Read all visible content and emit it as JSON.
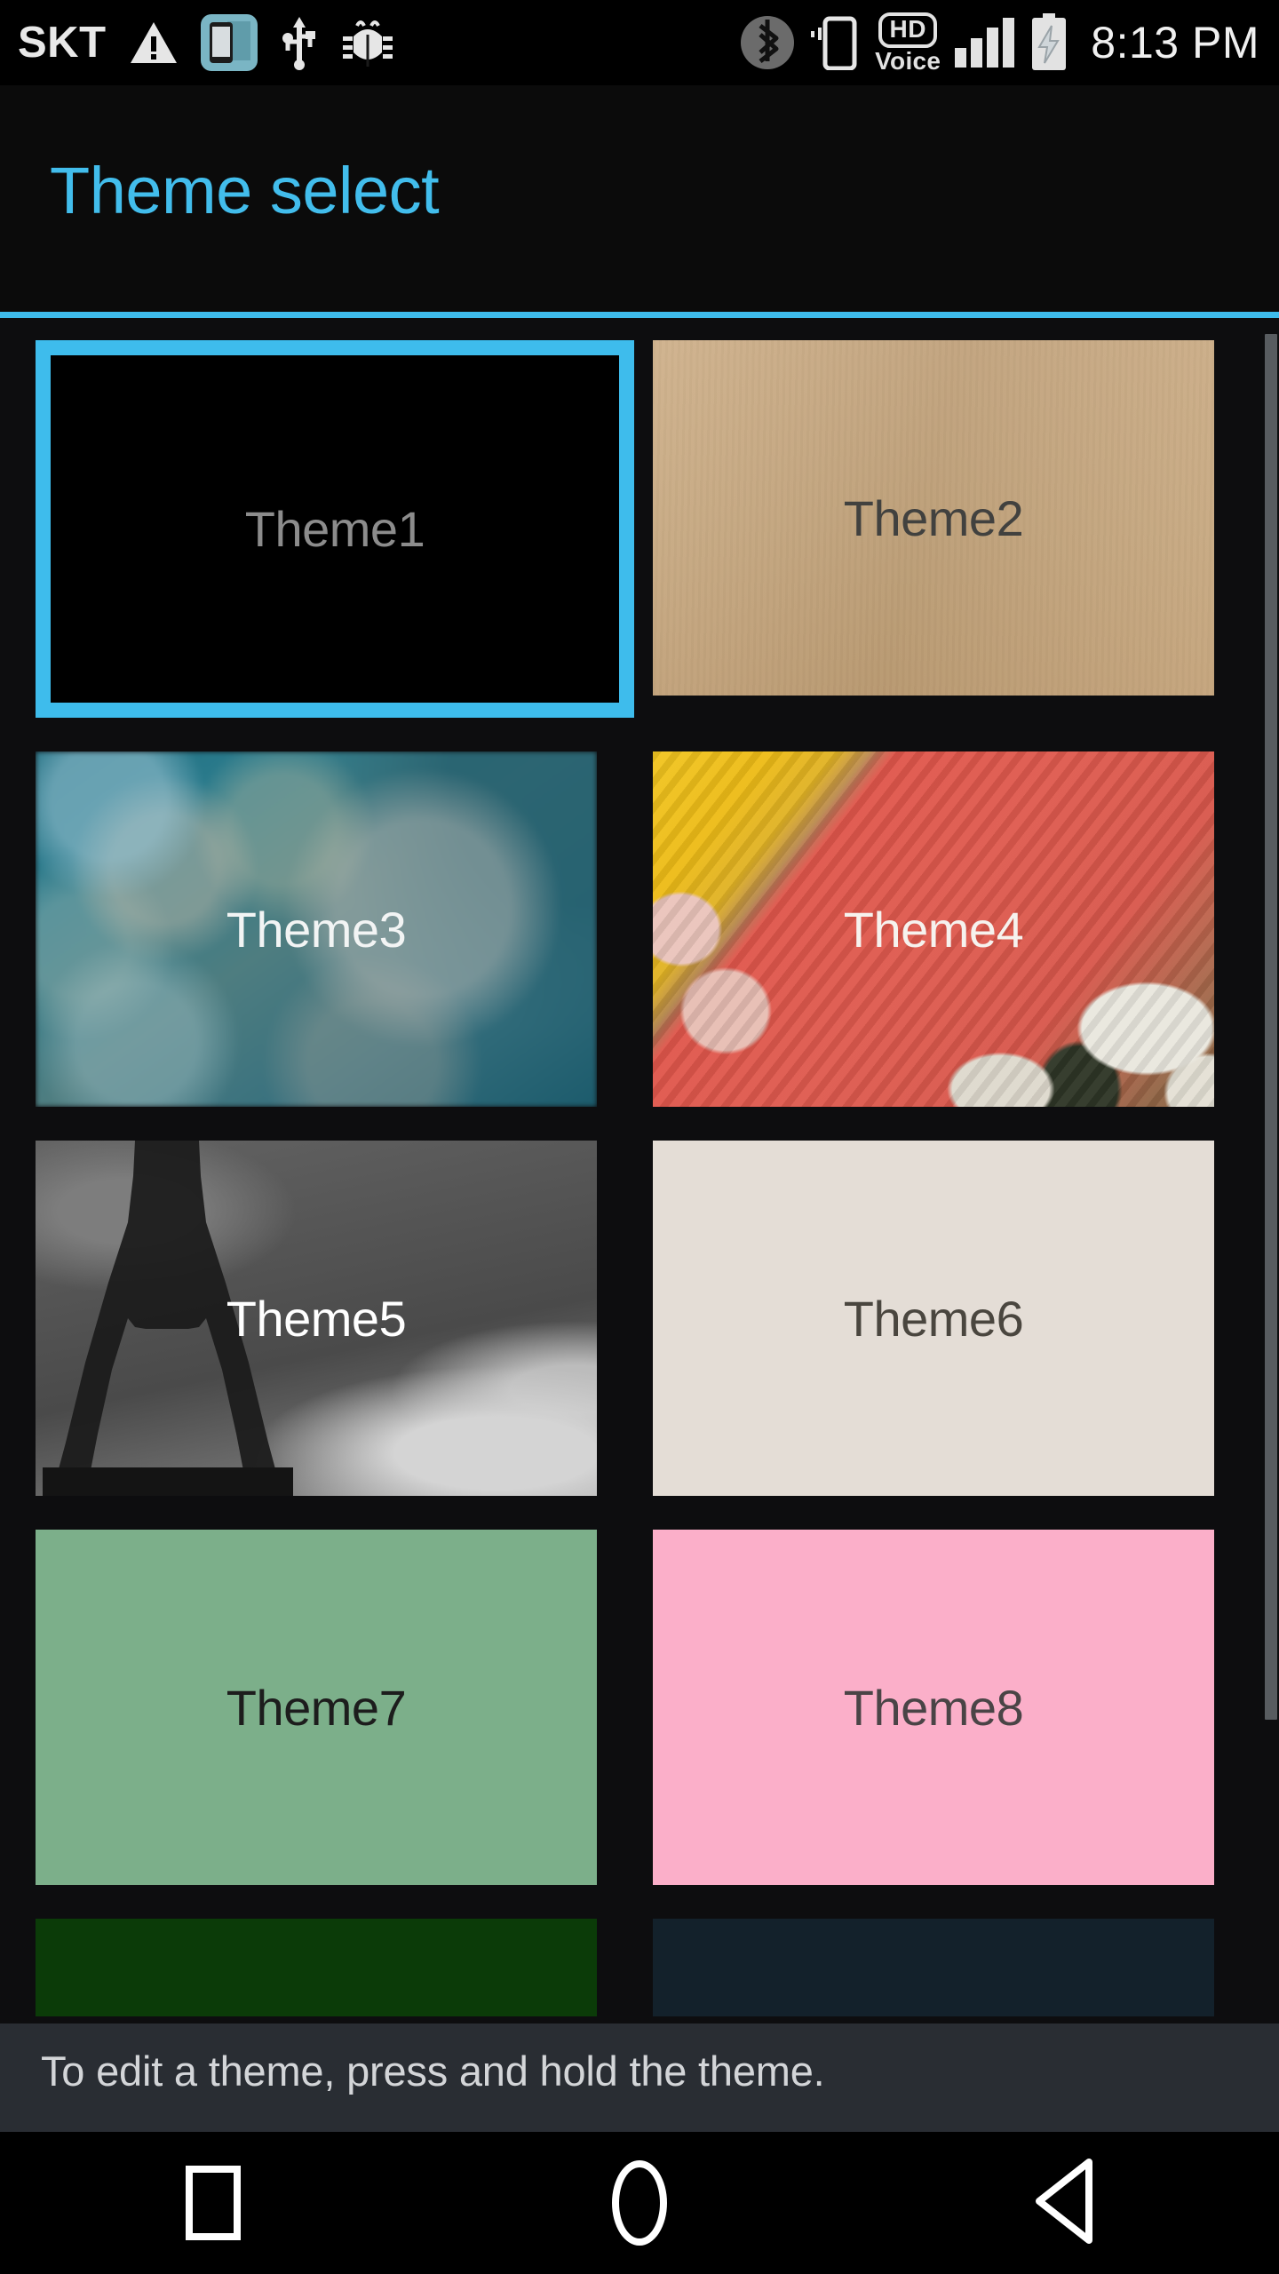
{
  "status_bar": {
    "carrier": "SKT",
    "clock": "8:13 PM",
    "hd_badge": "HD",
    "voice_label": "Voice",
    "icons": [
      "warning-triangle-icon",
      "smart-share-phone-icon",
      "usb-icon",
      "adb-bug-icon",
      "bluetooth-icon",
      "vibrate-phone-icon",
      "hd-voice-icon",
      "signal-bars-icon",
      "battery-charging-icon"
    ],
    "signal_bars": 4,
    "battery_charging": true
  },
  "action_bar": {
    "title": "Theme select",
    "accent_color": "#3ebcec"
  },
  "content": {
    "hint": "To edit a theme, press and hold the theme.",
    "selected_theme": "Theme1",
    "themes": [
      {
        "label": "Theme1",
        "art": "art-black",
        "text_color": "#8c8c8c",
        "swatch": "#000000",
        "selected": true,
        "partial": false
      },
      {
        "label": "Theme2",
        "art": "art-paper",
        "text_color": "#41413f",
        "swatch": "#c7a87f",
        "selected": false,
        "partial": false
      },
      {
        "label": "Theme3",
        "art": "art-bokeh",
        "text_color": "#f2f4f4",
        "swatch": "#2b7b8c",
        "selected": false,
        "partial": false
      },
      {
        "label": "Theme4",
        "art": "art-macaron",
        "text_color": "#f6f2ee",
        "swatch": "#d8574b",
        "selected": false,
        "partial": false
      },
      {
        "label": "Theme5",
        "art": "art-eiffel",
        "text_color": "#ffffff",
        "swatch": "#6e6e6e",
        "selected": false,
        "partial": false
      },
      {
        "label": "Theme6",
        "art": "art-cream",
        "text_color": "#4a463f",
        "swatch": "#e4ddd6",
        "selected": false,
        "partial": false
      },
      {
        "label": "Theme7",
        "art": "art-green",
        "text_color": "#1d1d1d",
        "swatch": "#7caf8a",
        "selected": false,
        "partial": false
      },
      {
        "label": "Theme8",
        "art": "art-pink",
        "text_color": "#4a4446",
        "swatch": "#fbafc9",
        "selected": false,
        "partial": false
      },
      {
        "label": "",
        "art": "art-darkgreen",
        "text_color": "#cccccc",
        "swatch": "#0b3b08",
        "selected": false,
        "partial": true
      },
      {
        "label": "",
        "art": "art-darknavy",
        "text_color": "#cccccc",
        "swatch": "#13212b",
        "selected": false,
        "partial": true
      }
    ]
  },
  "scrollbar": {
    "visible": true,
    "thumb_color": "#585c60"
  },
  "nav_bar": {
    "buttons": [
      {
        "name": "recents-button",
        "icon": "square-icon"
      },
      {
        "name": "home-button",
        "icon": "circle-icon"
      },
      {
        "name": "back-button",
        "icon": "triangle-left-icon"
      }
    ]
  }
}
